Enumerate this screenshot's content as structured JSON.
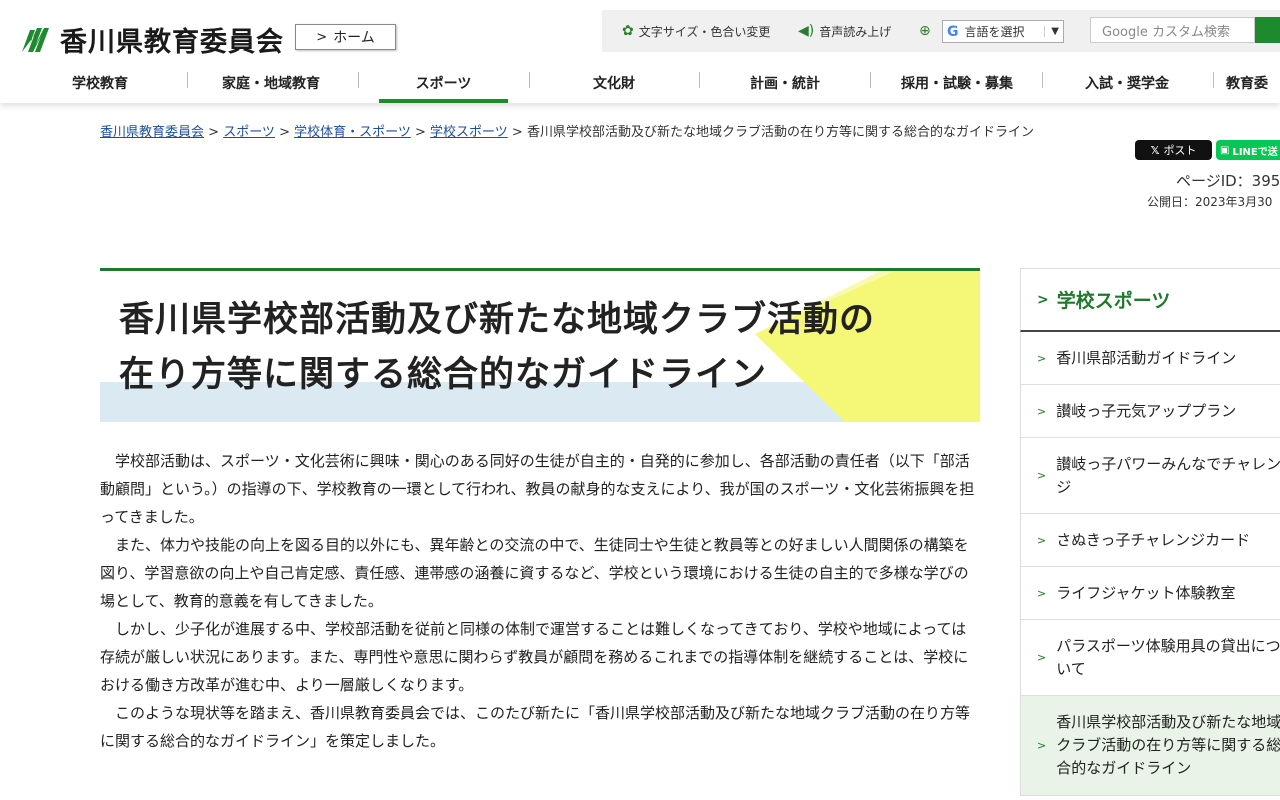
{
  "header": {
    "logo_text": "香川県教育委員会",
    "home_label": "ホーム",
    "util": {
      "font_color_label": "文字サイズ・色合い変更",
      "speech_label": "音声読み上げ",
      "lang_label": "言語を選択",
      "search_placeholder": "Google カスタム検索"
    }
  },
  "nav": {
    "items": [
      {
        "label": "学校教育"
      },
      {
        "label": "家庭・地域教育"
      },
      {
        "label": "スポーツ"
      },
      {
        "label": "文化財"
      },
      {
        "label": "計画・統計"
      },
      {
        "label": "採用・試験・募集"
      },
      {
        "label": "入試・奨学金"
      },
      {
        "label": "教育委"
      }
    ]
  },
  "breadcrumb": {
    "links": [
      "香川県教育委員会",
      "スポーツ",
      "学校体育・スポーツ",
      "学校スポーツ"
    ],
    "sep": " > ",
    "current": "香川県学校部活動及び新たな地域クラブ活動の在り方等に関する総合的なガイドライン"
  },
  "share": {
    "x_label": "ポスト",
    "line_label": "LINEで送"
  },
  "meta": {
    "page_id": "ページID：395",
    "published": "公開日：2023年3月30"
  },
  "article": {
    "title_line1": "香川県学校部活動及び新たな地域クラブ活動の",
    "title_line2": "在り方等に関する総合的なガイドライン",
    "paragraphs": [
      "学校部活動は、スポーツ・文化芸術に興味・関心のある同好の生徒が自主的・自発的に参加し、各部活動の責任者（以下「部活動顧問」という。）の指導の下、学校教育の一環として行われ、教員の献身的な支えにより、我が国のスポーツ・文化芸術振興を担ってきました。",
      "また、体力や技能の向上を図る目的以外にも、異年齢との交流の中で、生徒同士や生徒と教員等との好ましい人間関係の構築を図り、学習意欲の向上や自己肯定感、責任感、連帯感の涵養に資するなど、学校という環境における生徒の自主的で多様な学びの場として、教育的意義を有してきました。",
      "しかし、少子化が進展する中、学校部活動を従前と同様の体制で運営することは難しくなってきており、学校や地域によっては存続が厳しい状況にあります。また、専門性や意思に関わらず教員が顧問を務めるこれまでの指導体制を継続することは、学校における働き方改革が進む中、より一層厳しくなります。",
      "このような現状等を踏まえ、香川県教育委員会では、このたび新たに「香川県学校部活動及び新たな地域クラブ活動の在り方等に関する総合的なガイドライン」を策定しました。"
    ]
  },
  "sidebar": {
    "heading": "学校スポーツ",
    "items": [
      {
        "label": "香川県部活動ガイドライン"
      },
      {
        "label": "讃岐っ子元気アッププラン"
      },
      {
        "label": "讃岐っ子パワーみんなでチャレンジ"
      },
      {
        "label": "さぬきっ子チャレンジカード"
      },
      {
        "label": "ライフジャケット体験教室"
      },
      {
        "label": "パラスポーツ体験用具の貸出について"
      },
      {
        "label": "香川県学校部活動及び新たな地域クラブ活動の在り方等に関する総合的なガイドライン"
      }
    ]
  },
  "colors": {
    "brand_green": "#1d7a2a",
    "link_blue": "#1c4e9a",
    "title_yellow": "#f8f870",
    "title_band": "#dbe9f2"
  }
}
